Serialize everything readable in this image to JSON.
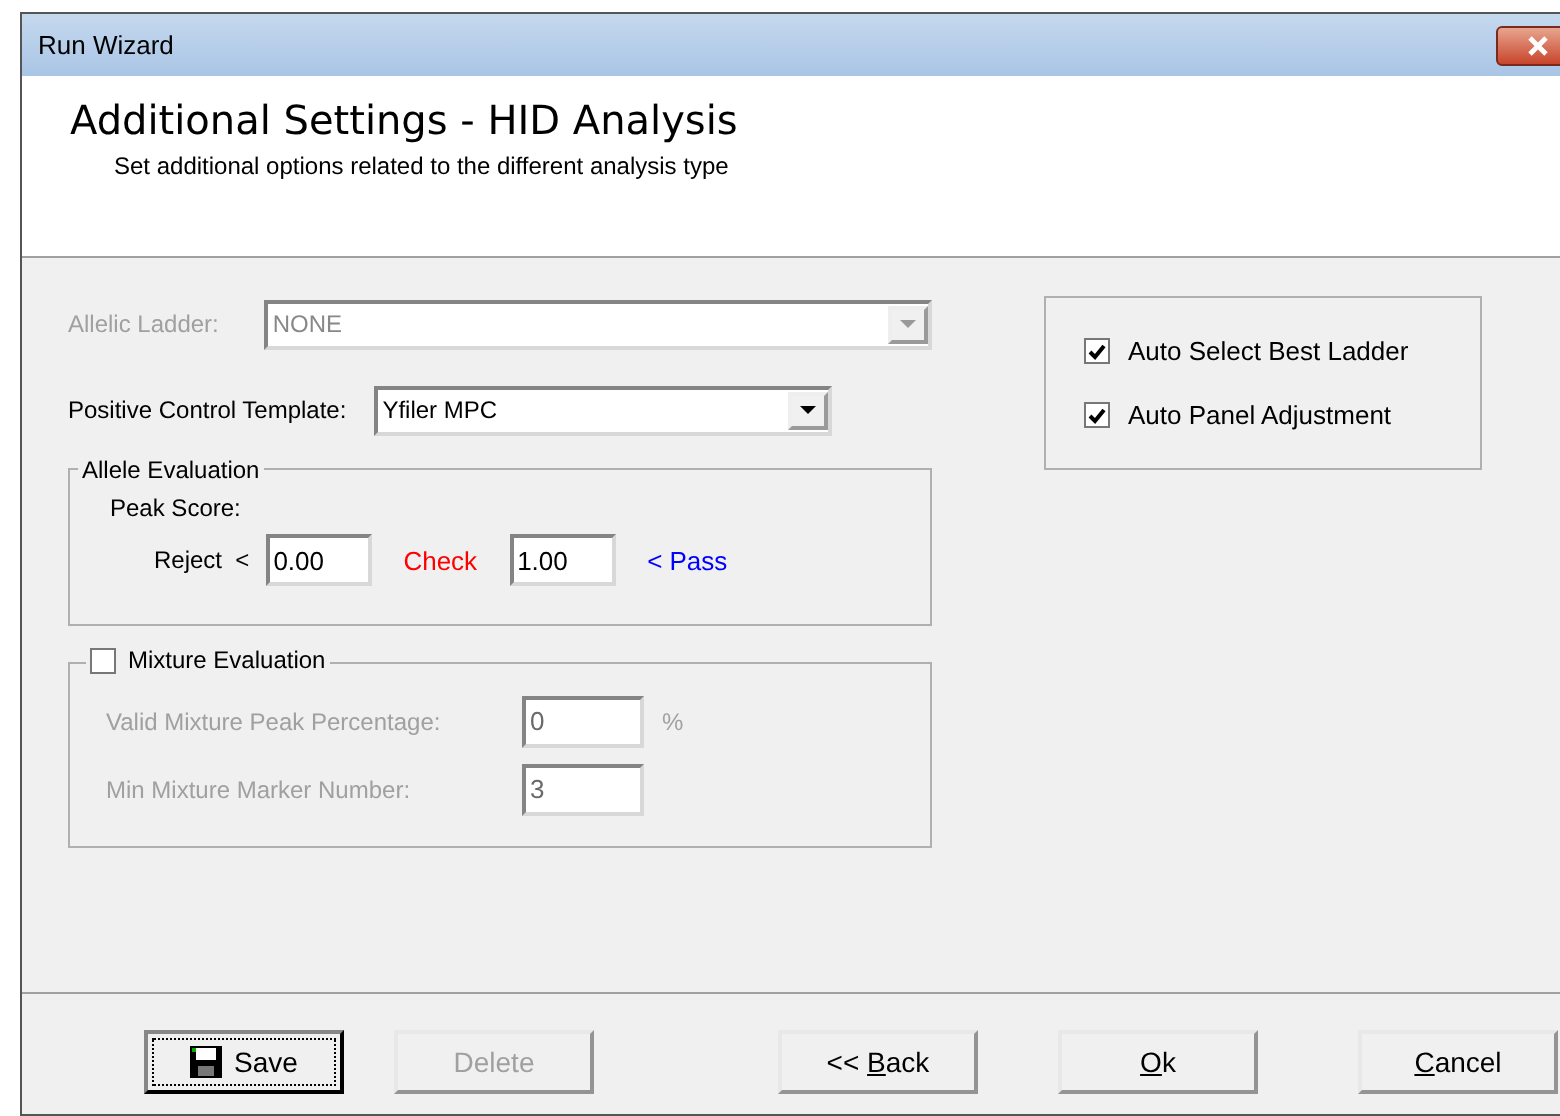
{
  "window": {
    "title": "Run Wizard"
  },
  "header": {
    "title": "Additional Settings - HID Analysis",
    "subtitle": "Set additional options related to the different analysis type"
  },
  "allelic_ladder": {
    "label": "Allelic Ladder:",
    "value": "NONE",
    "disabled": true
  },
  "positive_control": {
    "label": "Positive Control Template:",
    "value": "Yfiler MPC",
    "disabled": false
  },
  "allele_evaluation": {
    "title": "Allele Evaluation",
    "peak_score_label": "Peak Score:",
    "reject_label": "Reject  <",
    "reject_value": "0.00",
    "check_label": "Check",
    "check_value": "1.00",
    "pass_label": "< Pass"
  },
  "mixture_evaluation": {
    "title": "Mixture Evaluation",
    "checked": false,
    "fields": [
      {
        "label": "Valid Mixture Peak Percentage:",
        "value": "0",
        "unit": "%"
      },
      {
        "label": "Min Mixture Marker Number:",
        "value": "3"
      }
    ]
  },
  "options": [
    {
      "label": "Auto Select Best Ladder",
      "checked": true
    },
    {
      "label": "Auto Panel Adjustment",
      "checked": true
    }
  ],
  "buttons": [
    {
      "kind": "save",
      "before": "Save",
      "disabled": false,
      "focused": true
    },
    {
      "kind": "plain",
      "before": "Delete",
      "disabled": true,
      "focused": false
    },
    {
      "kind": "plain",
      "before": "<< ",
      "accel": "B",
      "after": "ack",
      "disabled": false,
      "focused": false
    },
    {
      "kind": "plain",
      "accel": "O",
      "after": "k",
      "disabled": false,
      "focused": false
    },
    {
      "kind": "plain",
      "accel": "C",
      "after": "ancel",
      "disabled": false,
      "focused": false
    }
  ]
}
